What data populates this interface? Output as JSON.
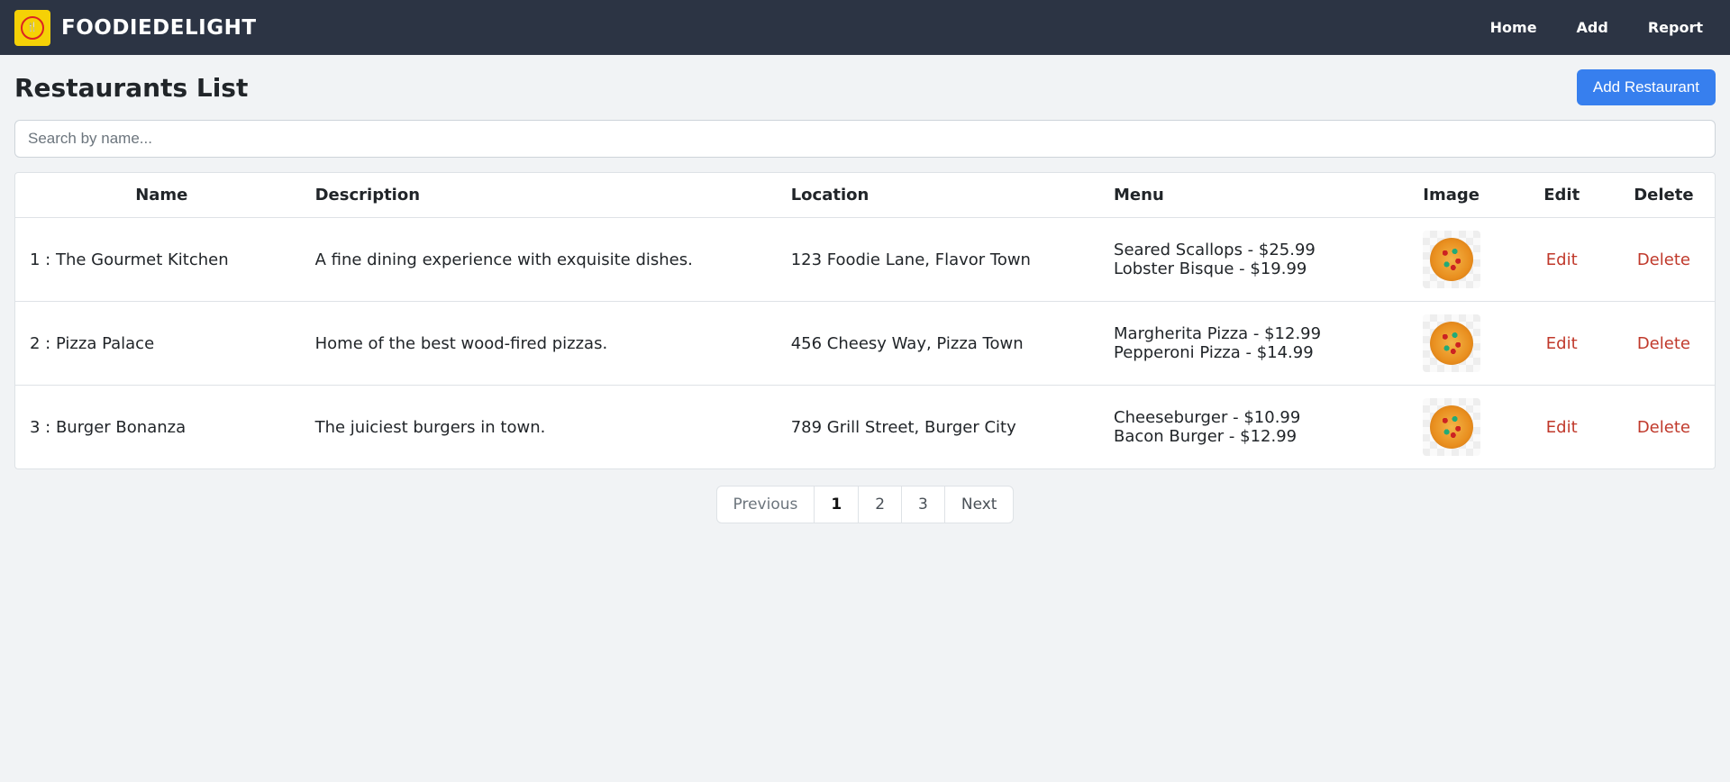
{
  "brand": "FOODIEDELIGHT",
  "nav": {
    "home": "Home",
    "add": "Add",
    "report": "Report"
  },
  "page": {
    "title": "Restaurants List",
    "add_button": "Add Restaurant",
    "search_placeholder": "Search by name..."
  },
  "table": {
    "headers": {
      "name": "Name",
      "description": "Description",
      "location": "Location",
      "menu": "Menu",
      "image": "Image",
      "edit": "Edit",
      "delete": "Delete"
    },
    "actions": {
      "edit": "Edit",
      "delete": "Delete"
    },
    "rows": [
      {
        "name": "1 : The Gourmet Kitchen",
        "description": "A fine dining experience with exquisite dishes.",
        "location": "123 Foodie Lane, Flavor Town",
        "menu": [
          "Seared Scallops - $25.99",
          "Lobster Bisque - $19.99"
        ]
      },
      {
        "name": "2 : Pizza Palace",
        "description": "Home of the best wood-fired pizzas.",
        "location": "456 Cheesy Way, Pizza Town",
        "menu": [
          "Margherita Pizza - $12.99",
          "Pepperoni Pizza - $14.99"
        ]
      },
      {
        "name": "3 : Burger Bonanza",
        "description": "The juiciest burgers in town.",
        "location": "789 Grill Street, Burger City",
        "menu": [
          "Cheeseburger - $10.99",
          "Bacon Burger - $12.99"
        ]
      }
    ]
  },
  "pagination": {
    "previous": "Previous",
    "next": "Next",
    "pages": [
      "1",
      "2",
      "3"
    ],
    "current": "1"
  }
}
